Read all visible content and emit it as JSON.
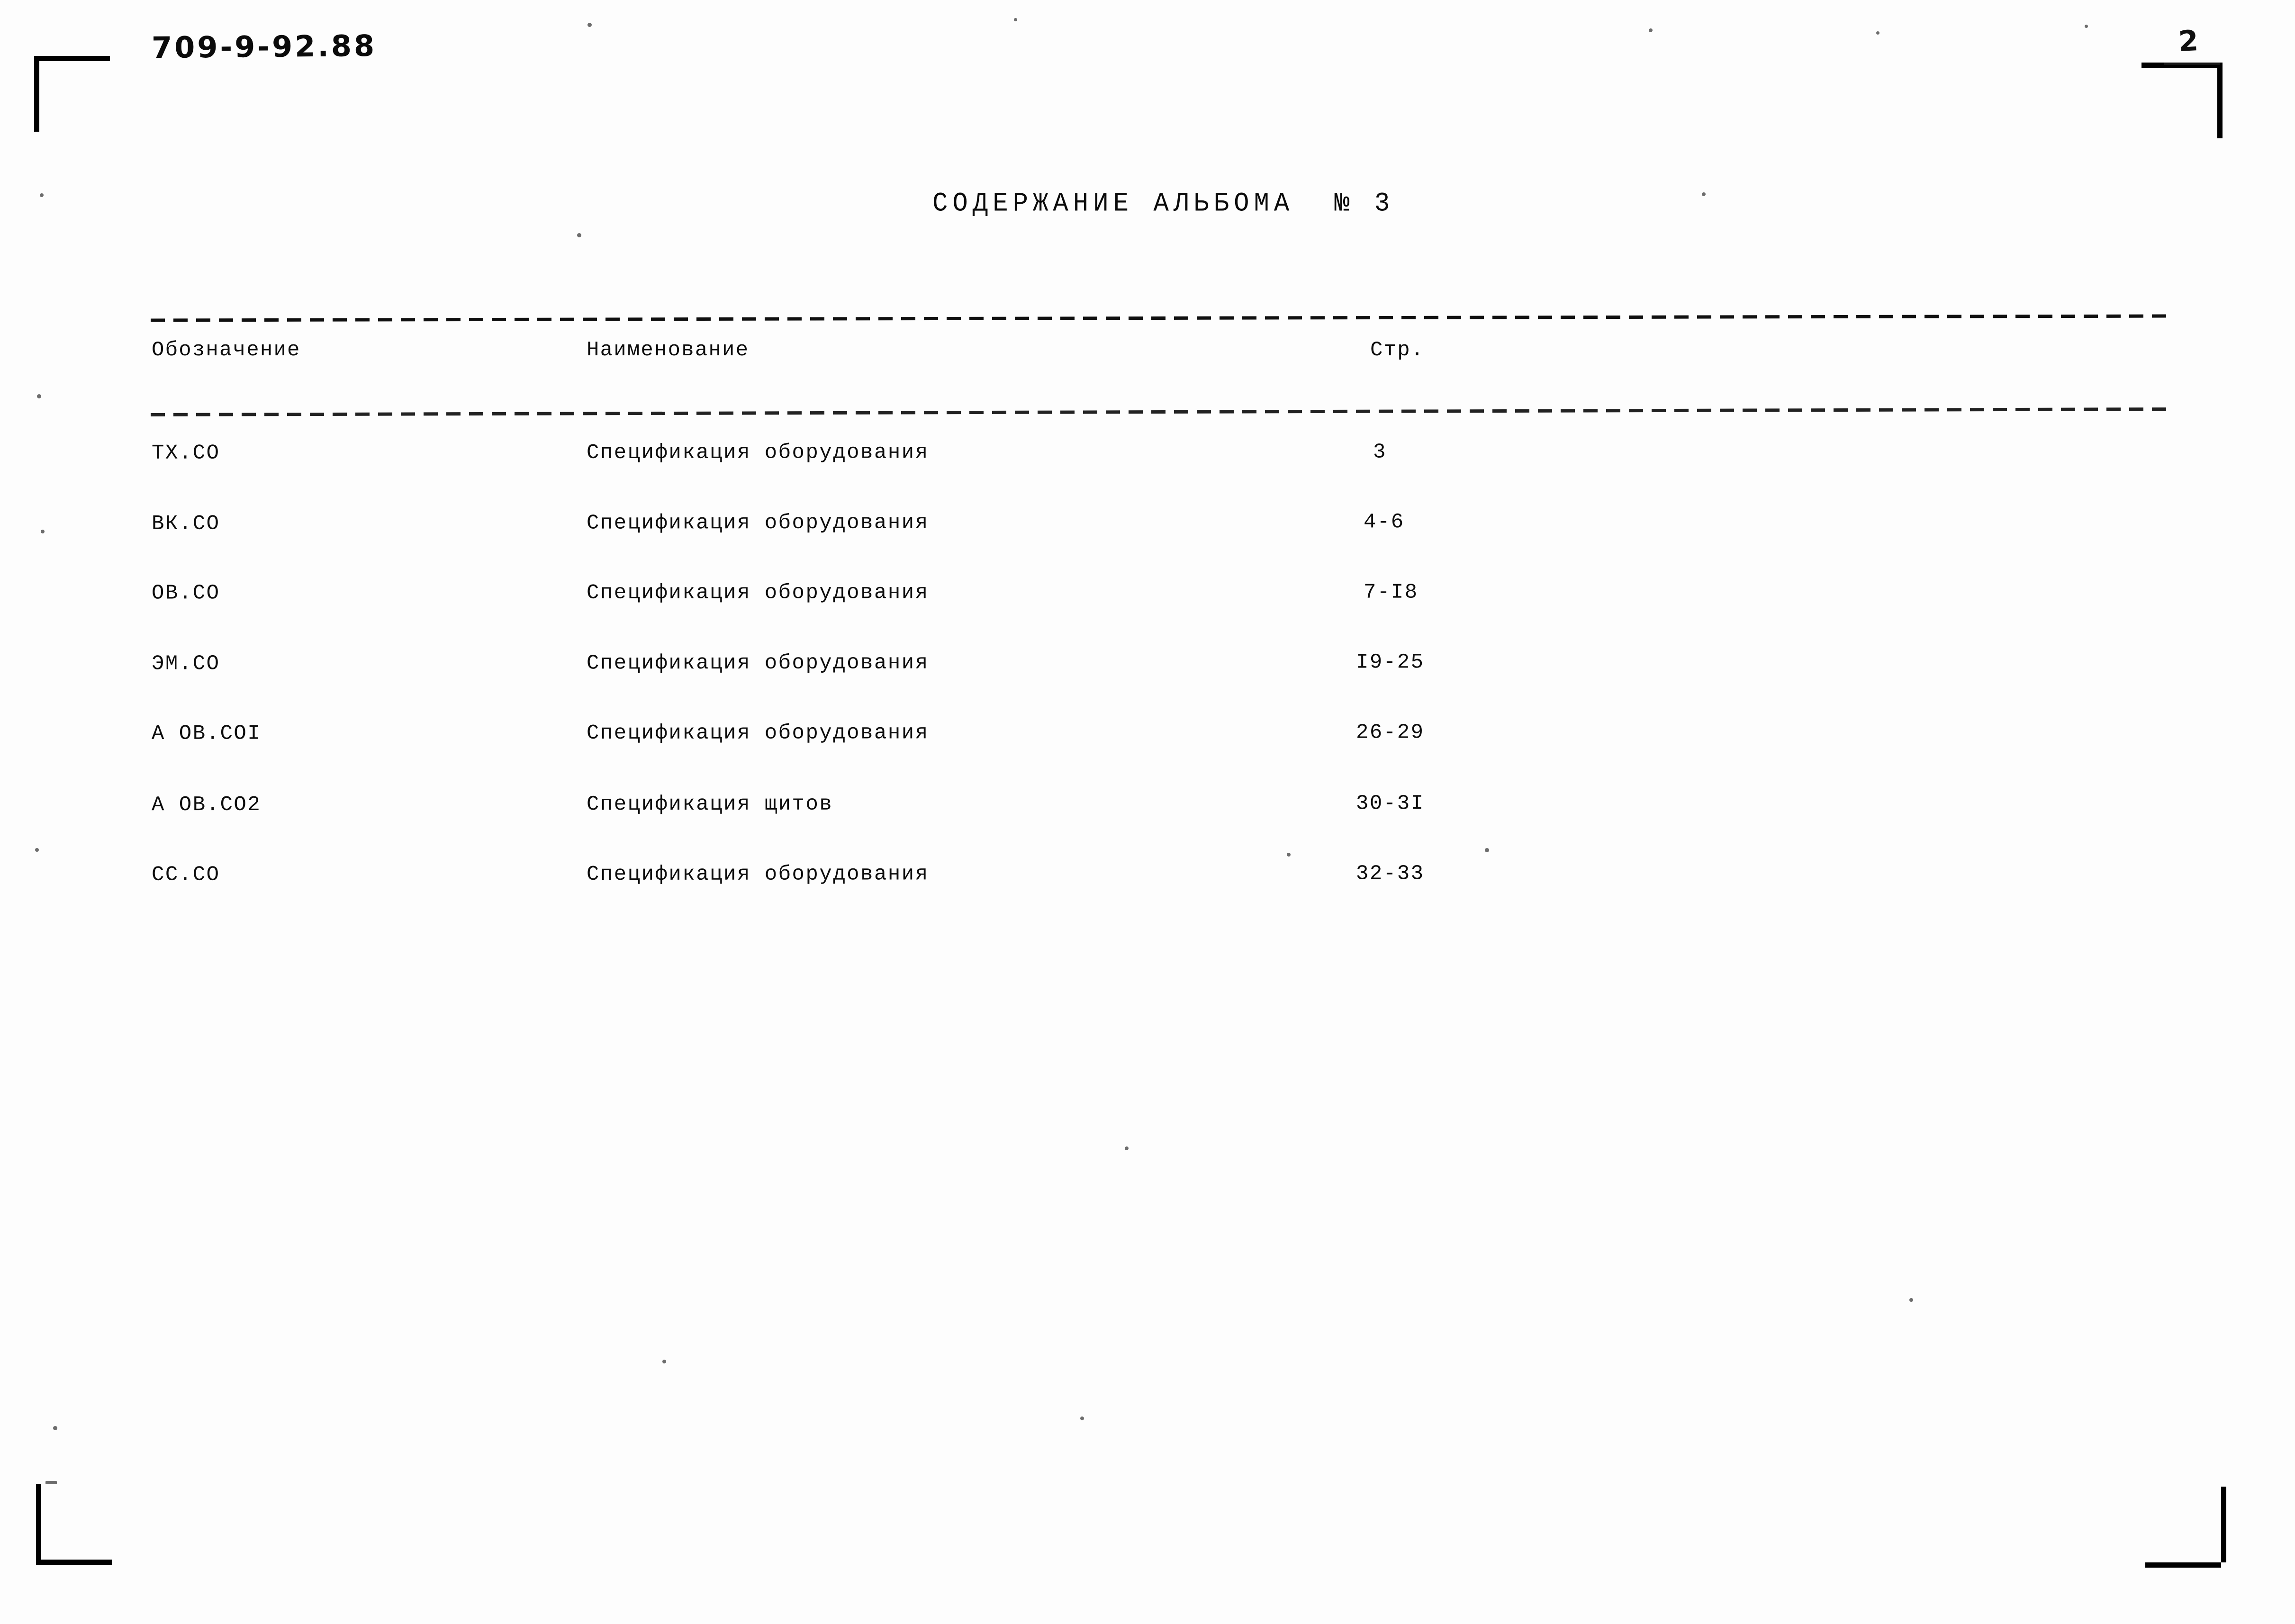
{
  "document": {
    "code": "709-9-92.88",
    "page_number": "2"
  },
  "title": "СОДЕРЖАНИЕ АЛЬБОМА  № 3",
  "table": {
    "headers": {
      "code": "Обозначение",
      "name": "Наименование",
      "page": "Стр."
    },
    "rows": [
      {
        "code": "ТХ.СО",
        "name": "Спецификация оборудования",
        "page": "3"
      },
      {
        "code": "ВК.СО",
        "name": "Спецификация оборудования",
        "page": "4-6"
      },
      {
        "code": "ОВ.СО",
        "name": "Спецификация оборудования",
        "page": "7-I8"
      },
      {
        "code": "ЭМ.СО",
        "name": "Спецификация оборудования",
        "page": "I9-25"
      },
      {
        "code": "А ОВ.СОI",
        "name": "Спецификация оборудования",
        "page": "26-29"
      },
      {
        "code": "А ОВ.СО2",
        "name": "Спецификация щитов",
        "page": "30-3I"
      },
      {
        "code": "СС.СО",
        "name": "Спецификация оборудования",
        "page": "32-33"
      }
    ]
  },
  "colors": {
    "ink": "#0d0d0d",
    "paper": "#fdfdfd",
    "speck": "#6d6d6d"
  }
}
